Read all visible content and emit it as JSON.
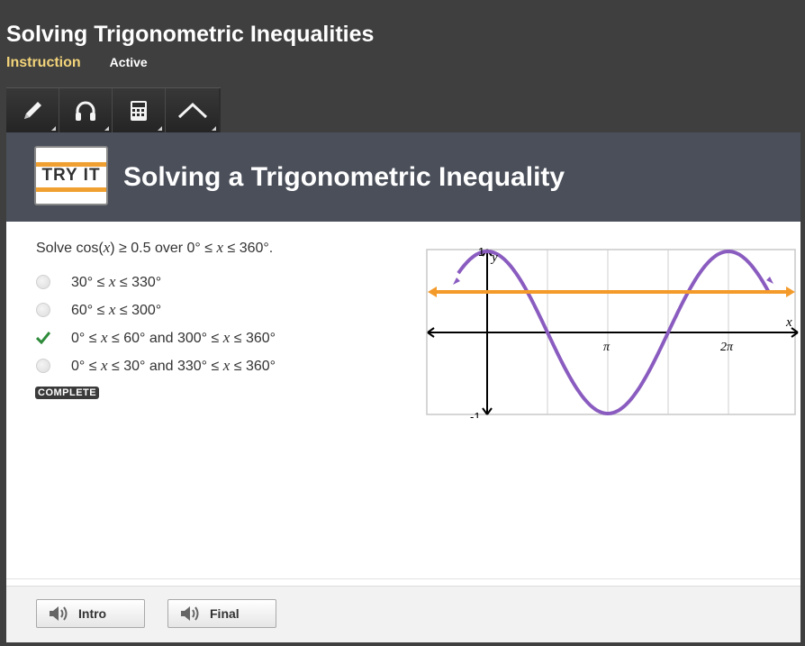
{
  "header": {
    "title": "Solving Trigonometric Inequalities",
    "instruction": "Instruction",
    "status": "Active"
  },
  "toolbar": {
    "tools": [
      {
        "icon": "pencil-icon"
      },
      {
        "icon": "headphones-icon"
      },
      {
        "icon": "calculator-icon"
      },
      {
        "icon": "graph-icon"
      }
    ]
  },
  "panel": {
    "badge": "TRY IT",
    "title": "Solving a Trigonometric Inequality"
  },
  "question": {
    "prefix": "Solve cos(",
    "var": "x",
    "suffix": ") ≥ 0.5 over 0° ≤ ",
    "var2": "x",
    "end": " ≤ 360°."
  },
  "options": [
    {
      "a": "30° ≤ ",
      "x": "x",
      "b": " ≤ 330°",
      "state": "unselected"
    },
    {
      "a": "60° ≤ ",
      "x": "x",
      "b": " ≤ 300°",
      "state": "unselected"
    },
    {
      "a": "0° ≤ ",
      "x": "x",
      "b": " ≤ 60° and 300° ≤ ",
      "x2": "x",
      "c": " ≤ 360°",
      "state": "correct"
    },
    {
      "a": "0° ≤ ",
      "x": "x",
      "b": " ≤ 30° and 330° ≤ ",
      "x2": "x",
      "c": " ≤ 360°",
      "state": "unselected"
    }
  ],
  "complete_label": "COMPLETE",
  "graph": {
    "y_label": "y",
    "x_label": "x",
    "y_max": "1",
    "y_min": "-1",
    "pi": "π",
    "two_pi": "2π",
    "curve_color": "#8a5cc0",
    "line_color": "#f39a2a"
  },
  "footer": {
    "intro_label": "Intro",
    "final_label": "Final"
  }
}
